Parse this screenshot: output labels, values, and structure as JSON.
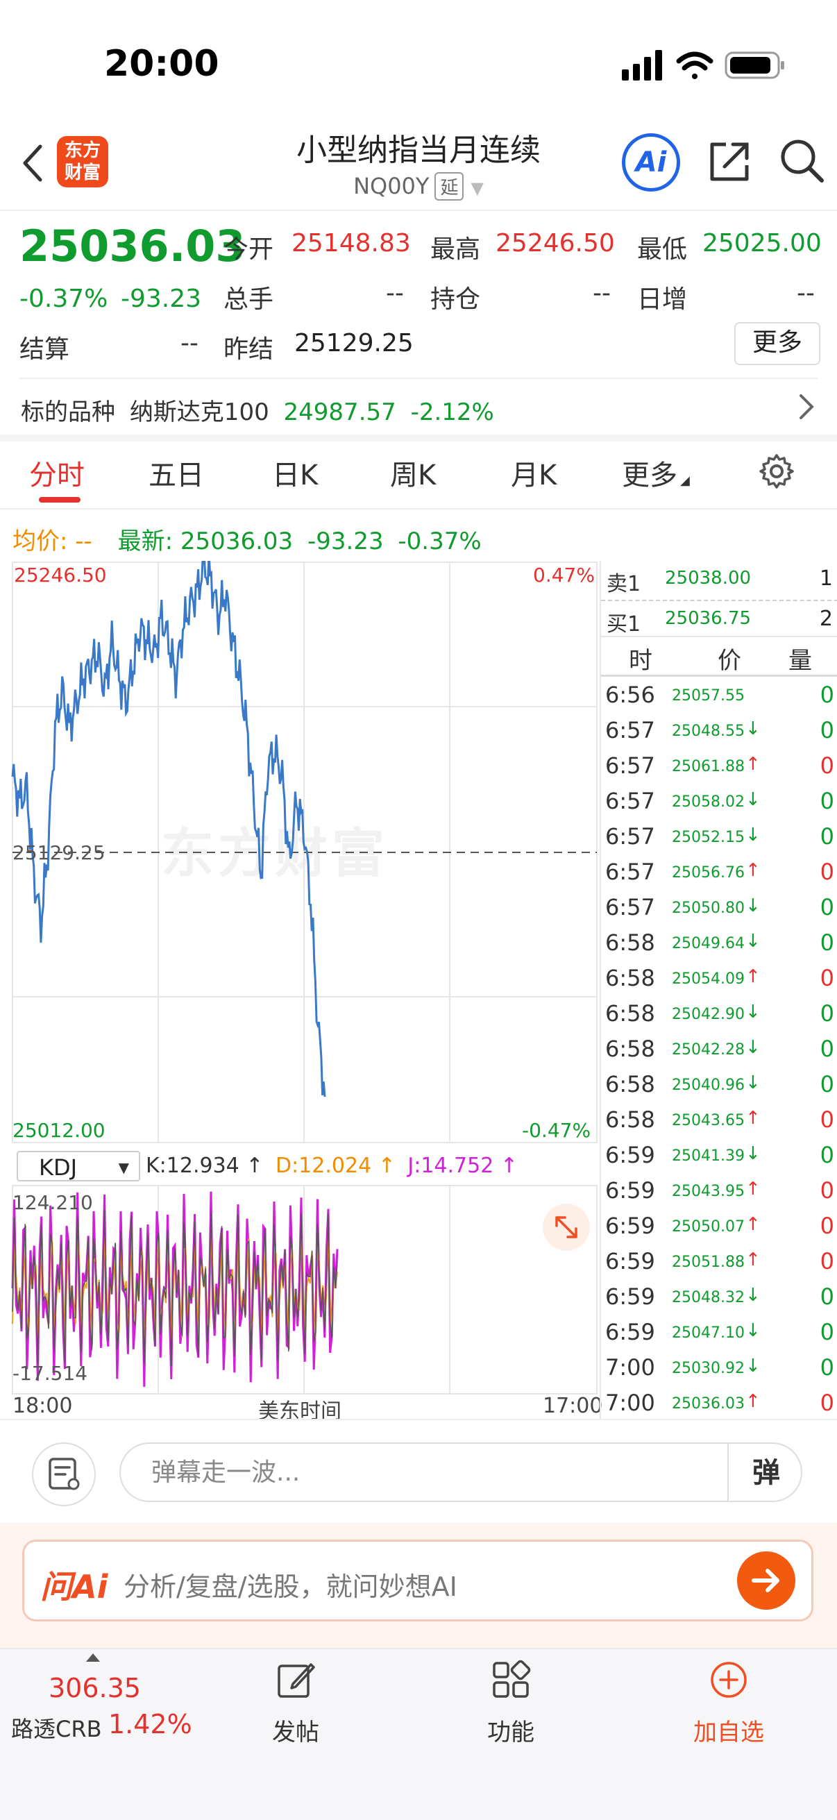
{
  "status": {
    "time": "20:00"
  },
  "header": {
    "logo_text": "东方财富",
    "title": "小型纳指当月连续",
    "code": "NQ00Y",
    "delay_tag": "延",
    "ai_label": "Ai"
  },
  "quote": {
    "price": "25036.03",
    "change_pct": "-0.37%",
    "change": "-93.23",
    "open_label": "今开",
    "open": "25148.83",
    "high_label": "最高",
    "high": "25246.50",
    "low_label": "最低",
    "low": "25025.00",
    "volume_label": "总手",
    "volume": "--",
    "oi_label": "持仓",
    "oi": "--",
    "daily_inc_label": "日增",
    "daily_inc": "--",
    "settle_label": "结算",
    "settle": "--",
    "prev_settle_label": "昨结",
    "prev_settle": "25129.25",
    "more_label": "更多"
  },
  "underlying": {
    "label": "标的品种",
    "name": "纳斯达克100",
    "price": "24987.57",
    "pct": "-2.12%"
  },
  "tabs": [
    "分时",
    "五日",
    "日K",
    "周K",
    "月K",
    "更多"
  ],
  "avg_line": {
    "avg_label": "均价:",
    "avg_val": "--",
    "latest_label": "最新:",
    "latest_val": "25036.03",
    "chg": "-93.23",
    "pct": "-0.37%"
  },
  "chart": {
    "y_top": "25246.50",
    "y_top_pct": "0.47%",
    "y_mid": "25129.25",
    "y_bot": "25012.00",
    "y_bot_pct": "-0.47%",
    "watermark": "东方财富",
    "x_start": "18:00",
    "x_mid": "美东时间",
    "x_end": "17:00"
  },
  "chart_data": {
    "type": "line",
    "title": "",
    "xlabel": "美东时间",
    "ylabel": "",
    "ylim": [
      25012.0,
      25246.5
    ],
    "x_ticks": [
      "18:00",
      "17:00"
    ],
    "reference": 25129.25,
    "series": [
      {
        "values": [
          25160,
          25150,
          25155,
          25120,
          25100,
          25130,
          25180,
          25195,
          25180,
          25190,
          25200,
          25205,
          25210,
          25195,
          25215,
          25200,
          25190,
          25205,
          25220,
          25215,
          25210,
          25225,
          25215,
          25200,
          25220,
          25230,
          25235,
          25246,
          25240,
          25225,
          25235,
          25215,
          25200,
          25180,
          25150,
          25120,
          25165,
          25170,
          25160,
          25125,
          25150,
          25140,
          25110,
          25060,
          25030
        ]
      }
    ]
  },
  "kdj": {
    "select": "KDJ",
    "k": "K:12.934 ↑",
    "d": "D:12.024 ↑",
    "j": "J:14.752 ↑",
    "hi": "124.210",
    "lo": "-17.514"
  },
  "orderbook": {
    "sell_label": "卖1",
    "sell_price": "25038.00",
    "sell_qty": "1",
    "buy_label": "买1",
    "buy_price": "25036.75",
    "buy_qty": "2",
    "head_time": "时",
    "head_price": "价",
    "head_vol": "量"
  },
  "ticks": [
    {
      "t": "6:56",
      "p": "25057.55",
      "dir": "",
      "v": "0"
    },
    {
      "t": "6:57",
      "p": "25048.55",
      "dir": "down",
      "v": "0"
    },
    {
      "t": "6:57",
      "p": "25061.88",
      "dir": "up",
      "v": "0"
    },
    {
      "t": "6:57",
      "p": "25058.02",
      "dir": "down",
      "v": "0"
    },
    {
      "t": "6:57",
      "p": "25052.15",
      "dir": "down",
      "v": "0"
    },
    {
      "t": "6:57",
      "p": "25056.76",
      "dir": "up",
      "v": "0"
    },
    {
      "t": "6:57",
      "p": "25050.80",
      "dir": "down",
      "v": "0"
    },
    {
      "t": "6:58",
      "p": "25049.64",
      "dir": "down",
      "v": "0"
    },
    {
      "t": "6:58",
      "p": "25054.09",
      "dir": "up",
      "v": "0"
    },
    {
      "t": "6:58",
      "p": "25042.90",
      "dir": "down",
      "v": "0"
    },
    {
      "t": "6:58",
      "p": "25042.28",
      "dir": "down",
      "v": "0"
    },
    {
      "t": "6:58",
      "p": "25040.96",
      "dir": "down",
      "v": "0"
    },
    {
      "t": "6:58",
      "p": "25043.65",
      "dir": "up",
      "v": "0"
    },
    {
      "t": "6:59",
      "p": "25041.39",
      "dir": "down",
      "v": "0"
    },
    {
      "t": "6:59",
      "p": "25043.95",
      "dir": "up",
      "v": "0"
    },
    {
      "t": "6:59",
      "p": "25050.07",
      "dir": "up",
      "v": "0"
    },
    {
      "t": "6:59",
      "p": "25051.88",
      "dir": "up",
      "v": "0"
    },
    {
      "t": "6:59",
      "p": "25048.32",
      "dir": "down",
      "v": "0"
    },
    {
      "t": "6:59",
      "p": "25047.10",
      "dir": "down",
      "v": "0"
    },
    {
      "t": "7:00",
      "p": "25030.92",
      "dir": "down",
      "v": "0"
    },
    {
      "t": "7:00",
      "p": "25036.03",
      "dir": "up",
      "v": "0"
    }
  ],
  "bullet": {
    "placeholder": "弹幕走一波...",
    "dan": "弹"
  },
  "ask_ai": {
    "logo": "问Ai",
    "text": "分析/复盘/选股，就问妙想AI"
  },
  "bottom": {
    "crb_price": "306.35",
    "crb_name": "路透CRB",
    "crb_pct": "1.42%",
    "post": "发帖",
    "func": "功能",
    "add": "加自选"
  },
  "colors": {
    "up": "#e5312d",
    "down": "#0f9b2e",
    "line": "#3a78c8",
    "accent": "#f04e23"
  }
}
